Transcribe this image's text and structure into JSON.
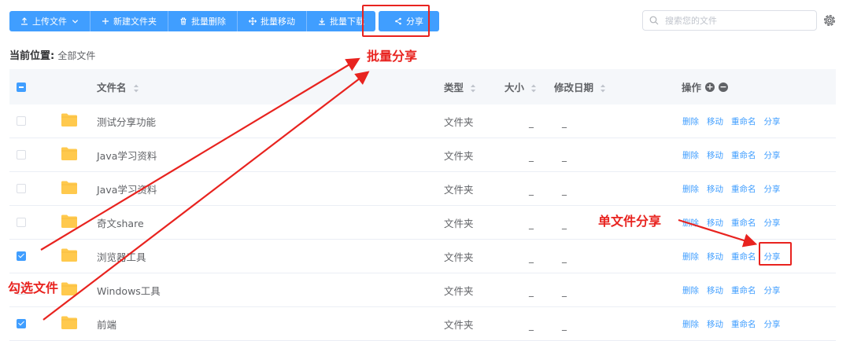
{
  "toolbar": {
    "upload": "上传文件",
    "new_folder": "新建文件夹",
    "batch_delete": "批量删除",
    "batch_move": "批量移动",
    "batch_download": "批量下载",
    "share": "分享"
  },
  "search": {
    "placeholder": "搜索您的文件"
  },
  "breadcrumb": {
    "label": "当前位置:",
    "item": "全部文件"
  },
  "columns": {
    "name": "文件名",
    "type": "类型",
    "size": "大小",
    "date": "修改日期",
    "ops": "操作"
  },
  "rows": [
    {
      "name": "测试分享功能",
      "type": "文件夹",
      "size": "_",
      "date": "_",
      "checked": false
    },
    {
      "name": "Java学习资料",
      "type": "文件夹",
      "size": "_",
      "date": "_",
      "checked": false
    },
    {
      "name": "Java学习资料",
      "type": "文件夹",
      "size": "_",
      "date": "_",
      "checked": false
    },
    {
      "name": "奇文share",
      "type": "文件夹",
      "size": "_",
      "date": "_",
      "checked": false
    },
    {
      "name": "浏览器工具",
      "type": "文件夹",
      "size": "_",
      "date": "_",
      "checked": true
    },
    {
      "name": "Windows工具",
      "type": "文件夹",
      "size": "_",
      "date": "_",
      "checked": false
    },
    {
      "name": "前端",
      "type": "文件夹",
      "size": "_",
      "date": "_",
      "checked": true
    }
  ],
  "row_ops": {
    "delete": "删除",
    "move": "移动",
    "rename": "重命名",
    "share": "分享"
  },
  "annotations": {
    "batch_share": "批量分享",
    "single_share": "单文件分享",
    "select_files": "勾选文件"
  },
  "colors": {
    "accent": "#409eff",
    "annotation": "#e8231f",
    "folder": "#ffc94d"
  }
}
